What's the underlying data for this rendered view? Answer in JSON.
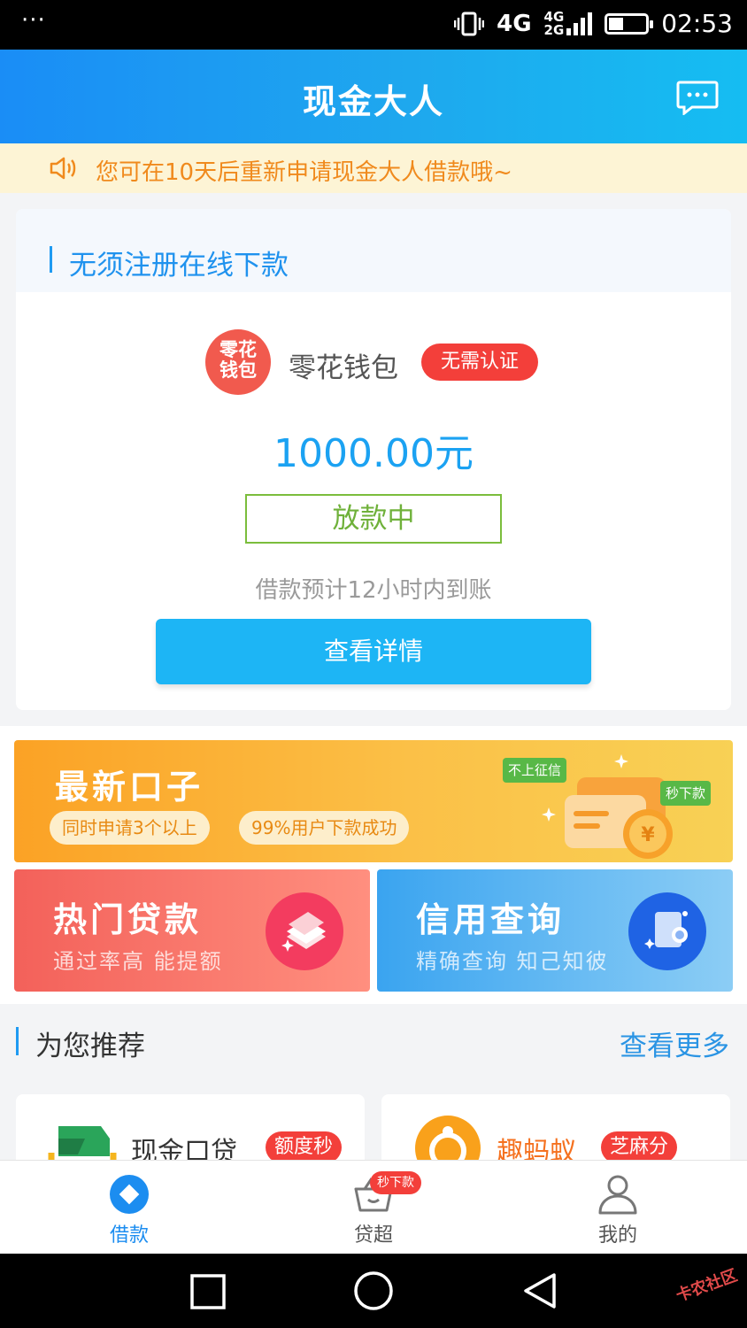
{
  "status_bar": {
    "network_4g": "4G",
    "net_small_top": "4G",
    "net_small_bottom": "2G",
    "time": "02:53",
    "dots": "···"
  },
  "header": {
    "title": "现金大人"
  },
  "notice": {
    "text": "您可在10天后重新申请现金大人借款哦~"
  },
  "loan_card": {
    "section_title": "无须注册在线下款",
    "logo_line1": "零花",
    "logo_line2": "钱包",
    "product_name": "零花钱包",
    "badge": "无需认证",
    "amount": "1000.00元",
    "status": "放款中",
    "eta": "借款预计12小时内到账",
    "detail_button": "查看详情"
  },
  "banners": {
    "newest": {
      "title": "最新口子",
      "pill1": "同时申请3个以上",
      "pill2": "99%用户下款成功",
      "tag1": "不上征信",
      "tag2": "秒下款"
    },
    "hot": {
      "title": "热门贷款",
      "subtitle": "通过率高 能提额"
    },
    "credit": {
      "title": "信用查询",
      "subtitle": "精确查询 知己知彼"
    }
  },
  "recommend": {
    "title": "为您推荐",
    "more": "查看更多",
    "items": [
      {
        "name": "现金口贷",
        "badge": "额度秒"
      },
      {
        "name": "趣蚂蚁",
        "badge": "芝麻分"
      }
    ]
  },
  "tabbar": {
    "tabs": [
      {
        "label": "借款",
        "active": true
      },
      {
        "label": "贷超",
        "badge": "秒下款"
      },
      {
        "label": "我的"
      }
    ]
  },
  "watermark": "卡农社区",
  "colors": {
    "primary": "#1a8df6",
    "accent_red": "#f33f3a",
    "status_green": "#6fb13a",
    "notice_orange": "#f08a1d"
  }
}
